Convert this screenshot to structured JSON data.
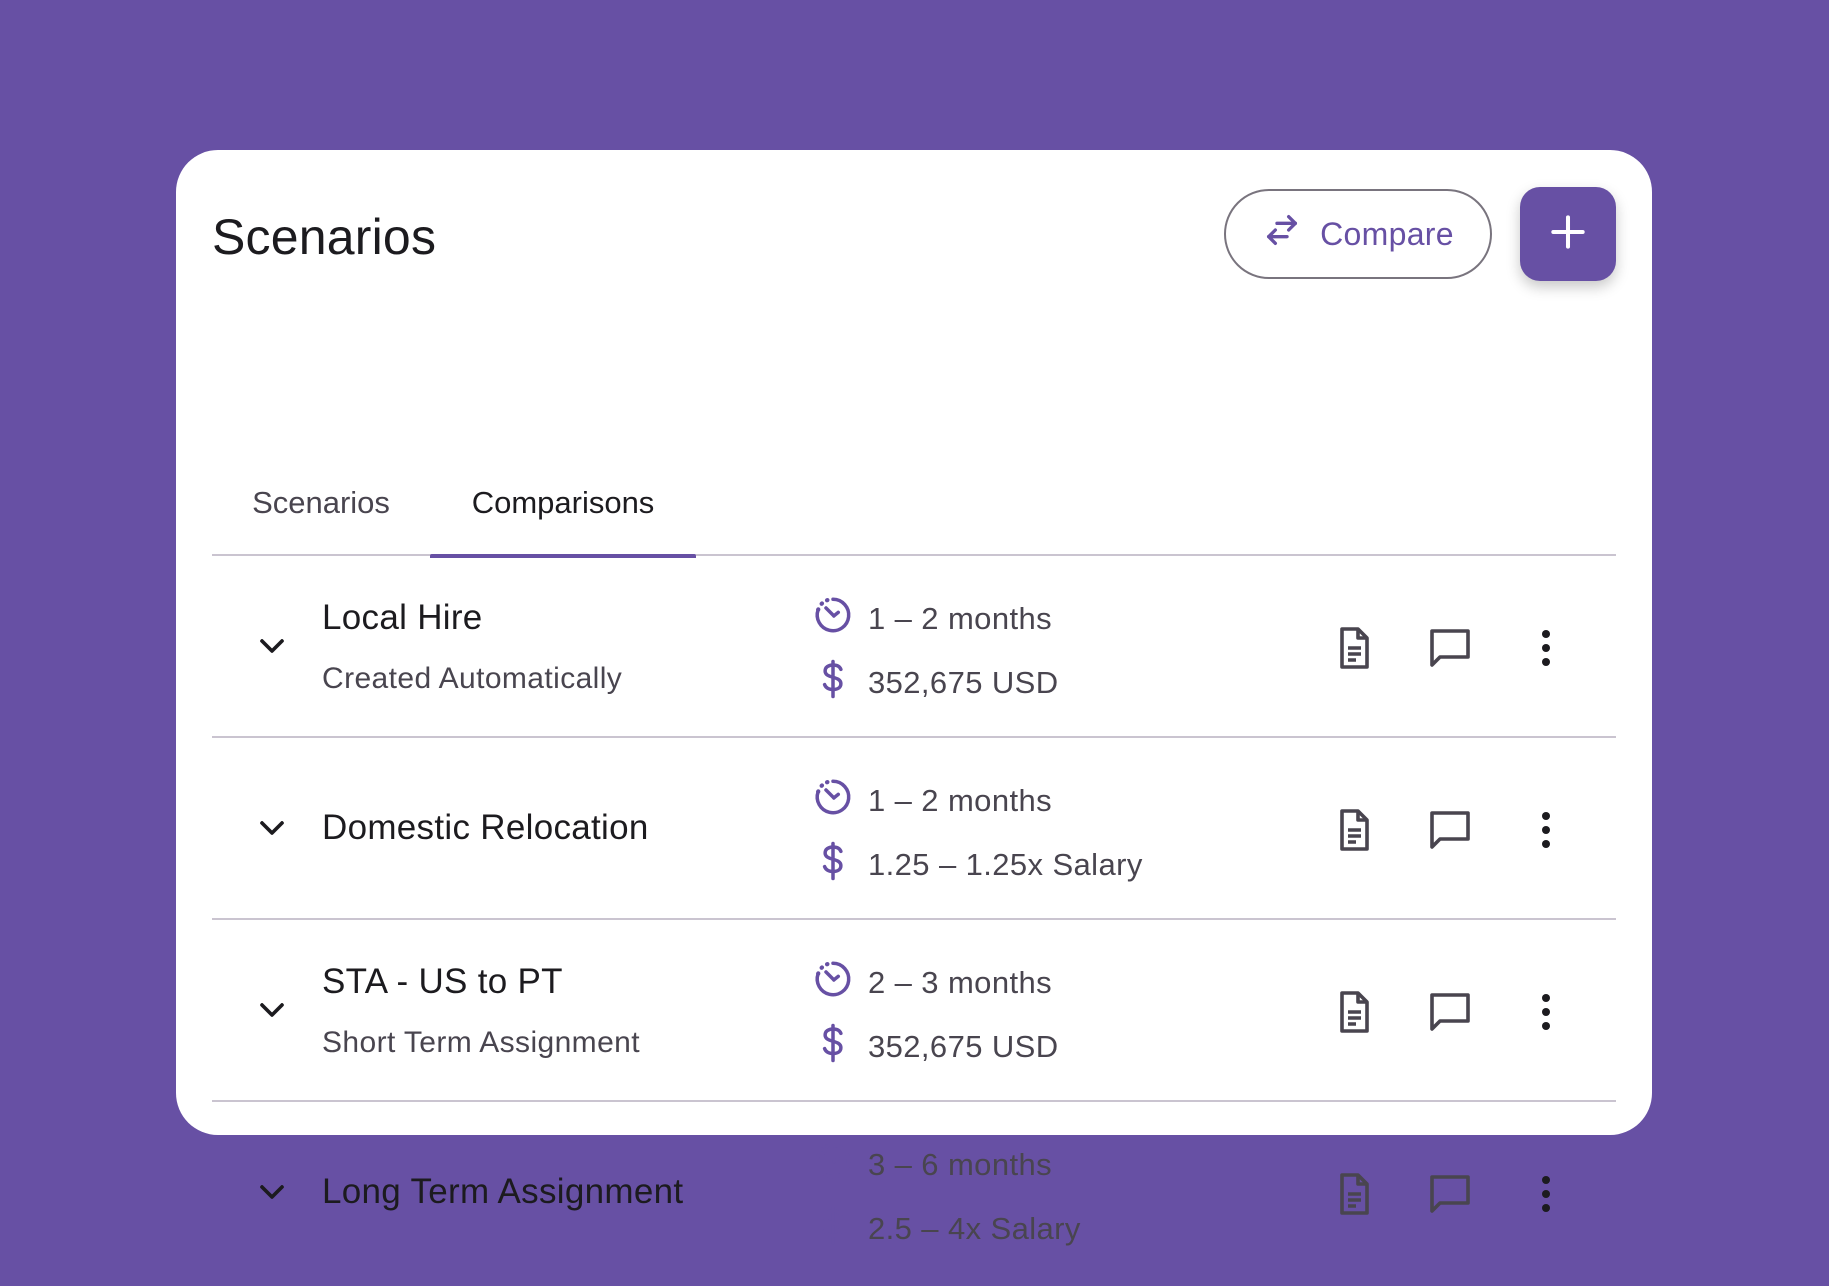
{
  "header": {
    "title": "Scenarios",
    "compare_label": "Compare"
  },
  "tabs": [
    {
      "label": "Scenarios",
      "active": false
    },
    {
      "label": "Comparisons",
      "active": true
    }
  ],
  "rows": [
    {
      "title": "Local Hire",
      "subtitle": "Created Automatically",
      "duration": "1 – 2 months",
      "cost": "352,675 USD"
    },
    {
      "title": "Domestic Relocation",
      "subtitle": "",
      "duration": "1 – 2 months",
      "cost": "1.25 – 1.25x Salary"
    },
    {
      "title": "STA - US to PT",
      "subtitle": "Short Term Assignment",
      "duration": "2 – 3 months",
      "cost": "352,675 USD"
    },
    {
      "title": "Long Term Assignment",
      "subtitle": "",
      "duration": "3 – 6 months",
      "cost": "2.5 – 4x Salary"
    }
  ],
  "icons": {
    "compare": "compare-arrows-icon",
    "add": "plus-icon",
    "expand": "chevron-down-icon",
    "duration": "timer-icon",
    "cost": "dollar-icon",
    "document": "document-icon",
    "comment": "comment-icon",
    "more": "more-vert-icon"
  },
  "colors": {
    "background": "#6750A4",
    "accent": "#6750A4",
    "text": "#1c1b1f",
    "secondary_text": "#49454f",
    "divider": "#cac4d0"
  }
}
